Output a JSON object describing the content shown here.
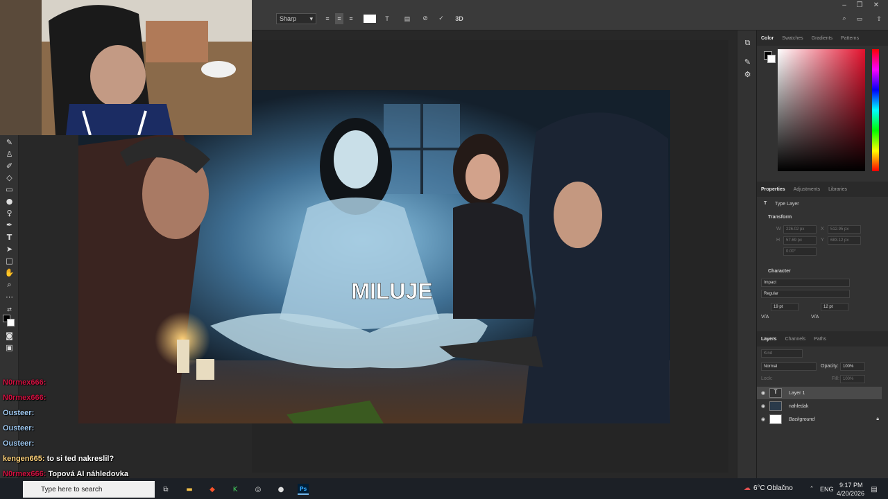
{
  "options_bar": {
    "antialias": "Sharp",
    "align_icons": [
      "align-left-icon",
      "align-center-icon",
      "align-right-icon"
    ],
    "color_swatch": "#ffffff"
  },
  "canvas": {
    "text_layer": "MILUJE",
    "text_font": "Impact"
  },
  "right_panel": {
    "color_tabs": [
      "Color",
      "Swatches",
      "Gradients",
      "Patterns"
    ],
    "props_tabs": [
      "Properties",
      "Adjustments",
      "Libraries"
    ],
    "type_layer_label": "Type Layer",
    "transform_label": "Transform",
    "transform_fields": {
      "w": "W",
      "w_val": "226.02 px",
      "x": "X",
      "x_val": "512.95 px",
      "h": "H",
      "h_val": "57.69 px",
      "y": "Y",
      "y_val": "683.12 px",
      "angle_val": "0.00°"
    },
    "character_label": "Character",
    "font_family": "Impact",
    "font_style": "Regular",
    "font_size": "19 pt",
    "leading": "12 pt",
    "tracking_label": "V/A",
    "kerning_label": "V/A",
    "layers_tabs": [
      "Layers",
      "Channels",
      "Paths"
    ],
    "kind_placeholder": "Kind",
    "blend_mode": "Normal",
    "opacity_label": "Opacity:",
    "opacity": "100%",
    "lock_label": "Lock:",
    "fill_label": "Fill:",
    "fill": "100%",
    "layers": [
      {
        "name": "Layer 1",
        "type": "text"
      },
      {
        "name": "nahledak",
        "type": "image"
      },
      {
        "name": "Background",
        "type": "background"
      }
    ]
  },
  "chat": [
    {
      "user": "N0rmex666:",
      "msg": "",
      "color": "red"
    },
    {
      "user": "N0rmex666:",
      "msg": "",
      "color": "red"
    },
    {
      "user": "Ousteer:",
      "msg": "",
      "color": "blue"
    },
    {
      "user": "Ousteer:",
      "msg": "",
      "color": "blue"
    },
    {
      "user": "Ousteer:",
      "msg": "",
      "color": "blue"
    },
    {
      "user": "kengen665:",
      "msg": "to si ted nakreslil?",
      "color": "gold"
    },
    {
      "user": "N0rmex666:",
      "msg": "Topová AI náhledovka",
      "color": "red"
    }
  ],
  "taskbar": {
    "search_placeholder": "Type here to search",
    "weather": "6°C  Oblačno",
    "lang": "ENG",
    "time": "9:17 PM",
    "date": "4/20/2026"
  }
}
